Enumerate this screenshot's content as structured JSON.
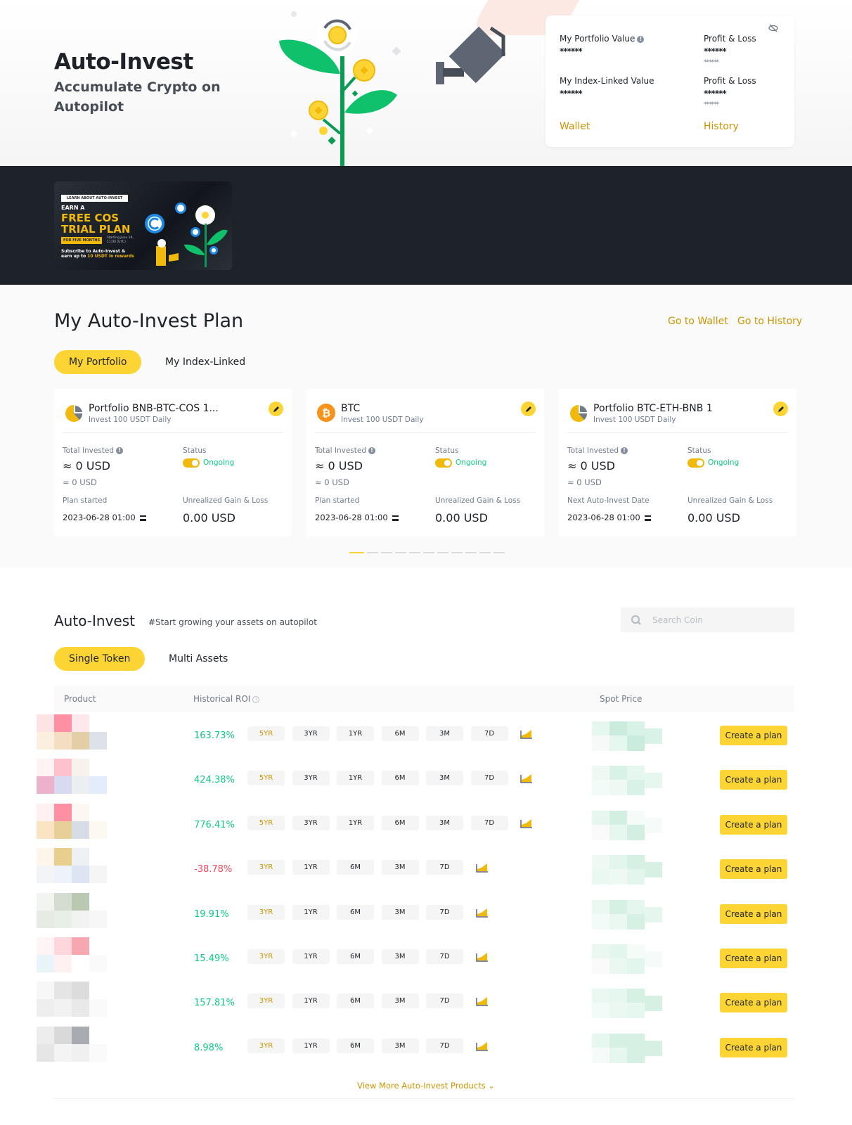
{
  "hero": {
    "title": "Auto-Invest",
    "subtitle": "Accumulate Crypto on Autopilot"
  },
  "summary": {
    "portfolio_value_label": "My Portfolio Value",
    "portfolio_value": "******",
    "portfolio_pl_label": "Profit & Loss",
    "portfolio_pl": "******",
    "portfolio_pl_sub": "******",
    "index_value_label": "My Index-Linked Value",
    "index_value": "******",
    "index_pl_label": "Profit & Loss",
    "index_pl": "******",
    "index_pl_sub": "******",
    "wallet_link": "Wallet",
    "history_link": "History"
  },
  "promo": {
    "tag": "LEARN ABOUT AUTO-INVEST",
    "earn": "EARN A",
    "headline_1": "FREE COS",
    "headline_2": "TRIAL PLAN",
    "pill": "FOR FIVE MONTHS",
    "start": "Starting June 19, 11:00 (UTC)",
    "footer_1": "Subscribe to Auto-Invest &",
    "footer_2": "earn up to",
    "footer_amount": "10 USDT",
    "footer_3": "in rewards"
  },
  "plan": {
    "title": "My Auto-Invest Plan",
    "go_wallet": "Go to Wallet",
    "go_history": "Go to History",
    "tabs": [
      {
        "label": "My Portfolio",
        "active": true
      },
      {
        "label": "My Index-Linked",
        "active": false
      }
    ],
    "cards": [
      {
        "icon": "portfolio-pie-icon",
        "name": "Portfolio BNB-BTC-COS 1...",
        "desc": "Invest 100 USDT Daily",
        "total_label": "Total Invested",
        "total": "≈ 0 USD",
        "total_sub": "≈ 0 USD",
        "status_label": "Status",
        "status": "Ongoing",
        "date_label": "Plan started",
        "date": "2023-06-28 01:00",
        "gain_label": "Unrealized Gain & Loss",
        "gain": "0.00 USD"
      },
      {
        "icon": "btc-icon",
        "name": "BTC",
        "desc": "Invest 100 USDT Daily",
        "total_label": "Total Invested",
        "total": "≈ 0 USD",
        "total_sub": "≈ 0 USD",
        "status_label": "Status",
        "status": "Ongoing",
        "date_label": "Plan started",
        "date": "2023-06-28 01:00",
        "gain_label": "Unrealized Gain & Loss",
        "gain": "0.00 USD"
      },
      {
        "icon": "portfolio-pie-icon",
        "name": "Portfolio BTC-ETH-BNB 1",
        "desc": "Invest 100 USDT Daily",
        "total_label": "Total Invested",
        "total": "≈ 0 USD",
        "total_sub": "≈ 0 USD",
        "status_label": "Status",
        "status": "Ongoing",
        "date_label": "Next Auto-Invest Date",
        "date": "2023-06-28 01:00",
        "gain_label": "Unrealized Gain & Loss",
        "gain": "0.00 USD"
      }
    ],
    "pagination": {
      "total": 11,
      "current": 1
    }
  },
  "auto_invest": {
    "title": "Auto-Invest",
    "subtitle": "#Start growing your assets on autopilot",
    "search_placeholder": "Search Coin",
    "tabs": [
      {
        "label": "Single Token",
        "active": true
      },
      {
        "label": "Multi Assets",
        "active": false
      }
    ],
    "columns": {
      "product": "Product",
      "roi": "Historical ROI",
      "spot": "Spot Price"
    },
    "create_label": "Create a plan",
    "rows": [
      {
        "roi": "163.73%",
        "trend": "pos",
        "periods": [
          "5YR",
          "3YR",
          "1YR",
          "6M",
          "3M",
          "7D"
        ],
        "active_period": "5YR"
      },
      {
        "roi": "424.38%",
        "trend": "pos",
        "periods": [
          "5YR",
          "3YR",
          "1YR",
          "6M",
          "3M",
          "7D"
        ],
        "active_period": "5YR"
      },
      {
        "roi": "776.41%",
        "trend": "pos",
        "periods": [
          "5YR",
          "3YR",
          "1YR",
          "6M",
          "3M",
          "7D"
        ],
        "active_period": "5YR"
      },
      {
        "roi": "-38.78%",
        "trend": "neg",
        "periods": [
          "3YR",
          "1YR",
          "6M",
          "3M",
          "7D"
        ],
        "active_period": "3YR"
      },
      {
        "roi": "19.91%",
        "trend": "pos",
        "periods": [
          "3YR",
          "1YR",
          "6M",
          "3M",
          "7D"
        ],
        "active_period": "3YR"
      },
      {
        "roi": "15.49%",
        "trend": "pos",
        "periods": [
          "3YR",
          "1YR",
          "6M",
          "3M",
          "7D"
        ],
        "active_period": "3YR"
      },
      {
        "roi": "157.81%",
        "trend": "pos",
        "periods": [
          "3YR",
          "1YR",
          "6M",
          "3M",
          "7D"
        ],
        "active_period": "3YR"
      },
      {
        "roi": "8.98%",
        "trend": "pos",
        "periods": [
          "3YR",
          "1YR",
          "6M",
          "3M",
          "7D"
        ],
        "active_period": "3YR"
      }
    ],
    "view_more": "View More Auto-Invest Products"
  },
  "colors": {
    "brand_yellow": "#fcd535",
    "link_gold": "#c99400",
    "positive": "#0ecb81",
    "negative": "#f6465d",
    "dark_bg": "#1e2329"
  }
}
